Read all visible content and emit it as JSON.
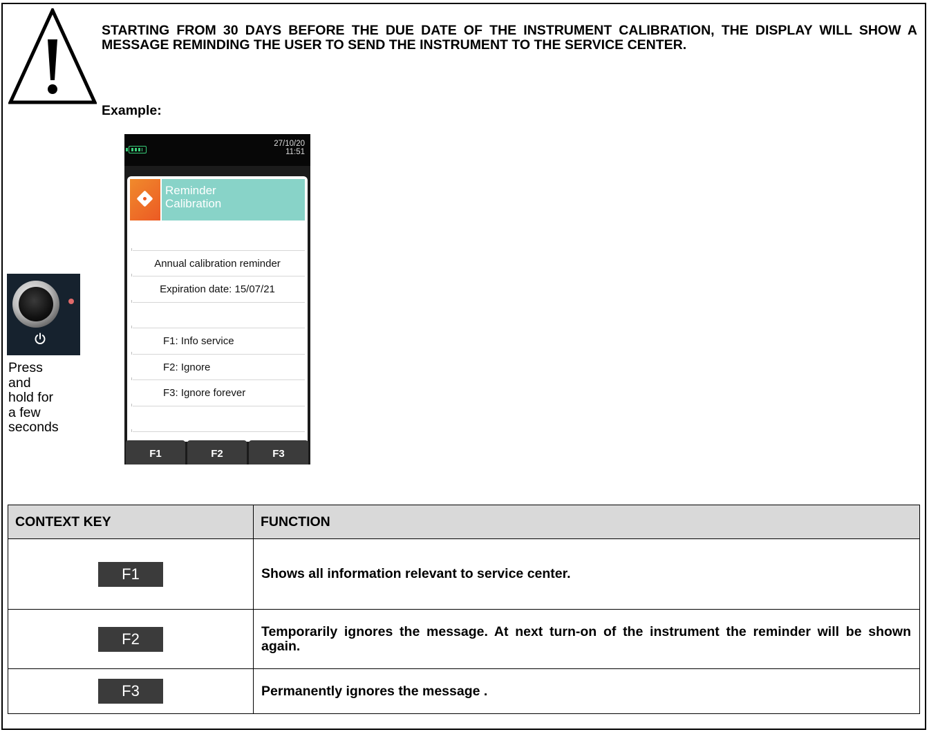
{
  "notice": {
    "text": "STARTING FROM 30 DAYS BEFORE THE DUE DATE OF THE INSTRUMENT CALIBRATION, THE DISPLAY WILL SHOW A MESSAGE REMINDING THE USER TO SEND THE INSTRUMENT TO THE SERVICE CENTER.",
    "icon": "warning-triangle-icon"
  },
  "example_label": "Example:",
  "power_button": {
    "icon": "power-icon",
    "instruction_lines": [
      "Press",
      "and",
      "hold for",
      "a few",
      "seconds"
    ]
  },
  "device": {
    "date": "27/10/20",
    "time": "11:51",
    "title_line1": "Reminder",
    "title_line2": "Calibration",
    "rows": [
      "",
      "Annual calibration reminder",
      "Expiration date: 15/07/21",
      "",
      "F1: Info service",
      "F2: Ignore",
      "F3: Ignore forever",
      ""
    ],
    "keys": [
      "F1",
      "F2",
      "F3"
    ],
    "colors": {
      "header_teal": "#88d3c8",
      "icon_orange": "#ec5a24",
      "battery_green": "#39d07a"
    }
  },
  "table": {
    "headers": [
      "CONTEXT KEY",
      "FUNCTION"
    ],
    "rows": [
      {
        "key": "F1",
        "function": "Shows all information relevant to service center."
      },
      {
        "key": "F2",
        "function": "Temporarily ignores the message. At next turn-on of the instrument the reminder will be shown again."
      },
      {
        "key": "F3",
        "function": "Permanently ignores the message ."
      }
    ]
  }
}
